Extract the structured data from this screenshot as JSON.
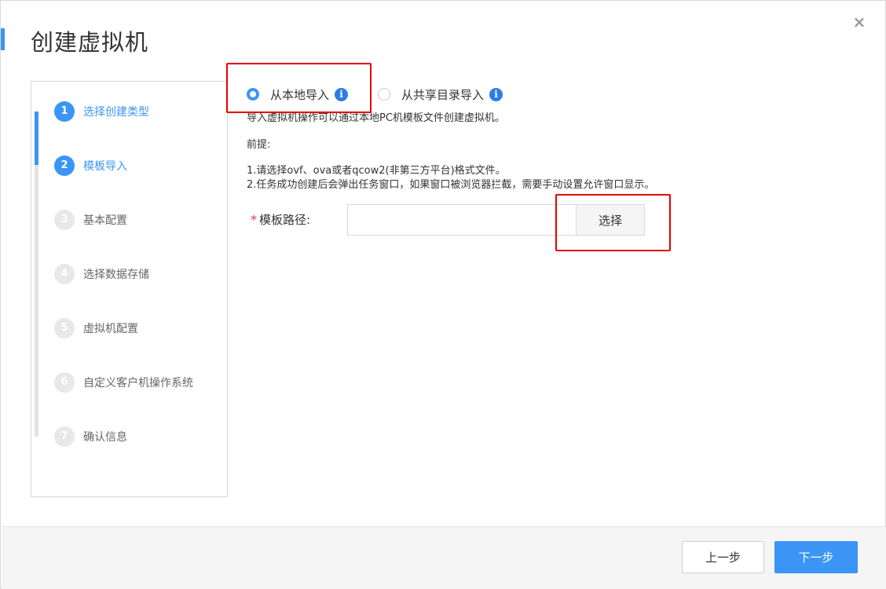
{
  "dialog": {
    "title": "创建虚拟机",
    "close_icon": "×",
    "accent_color": "#3b95f5"
  },
  "steps": [
    {
      "num": "1",
      "label": "选择创建类型",
      "active": true
    },
    {
      "num": "2",
      "label": "模板导入",
      "active": true
    },
    {
      "num": "3",
      "label": "基本配置",
      "active": false
    },
    {
      "num": "4",
      "label": "选择数据存储",
      "active": false
    },
    {
      "num": "5",
      "label": "虚拟机配置",
      "active": false
    },
    {
      "num": "6",
      "label": "自定义客户机操作系统",
      "active": false
    },
    {
      "num": "7",
      "label": "确认信息",
      "active": false
    }
  ],
  "import_options": {
    "local": {
      "label": "从本地导入",
      "checked": true,
      "icon": "info-icon"
    },
    "shared": {
      "label": "从共享目录导入",
      "checked": false,
      "icon": "info-icon"
    }
  },
  "description": "导入虚拟机操作可以通过本地PC机模板文件创建虚拟机。",
  "prerequisites": {
    "title": "前提:",
    "line1": "1.请选择ovf、ova或者qcow2(非第三方平台)格式文件。",
    "line2": "2.任务成功创建后会弹出任务窗口，如果窗口被浏览器拦截，需要手动设置允许窗口显示。"
  },
  "template_path": {
    "required_mark": "*",
    "label": "模板路径:",
    "value": "",
    "placeholder": "",
    "choose_label": "选择"
  },
  "footer": {
    "prev_label": "上一步",
    "next_label": "下一步"
  },
  "info_glyph": "i"
}
